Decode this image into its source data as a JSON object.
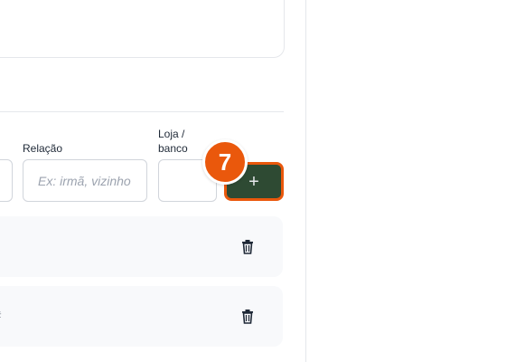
{
  "form": {
    "relacao_label": "Relação",
    "relacao_placeholder": "Ex: irmã, vizinho",
    "loja_label": "Loja / banco",
    "loja_value": "",
    "left_field_value": "",
    "add_label": "+"
  },
  "step_badge": "7",
  "list": {
    "items": [
      {
        "text": ""
      },
      {
        "text": "#"
      }
    ]
  },
  "colors": {
    "accent": "#ea580c",
    "button_bg": "#2e4a33",
    "card_bg": "#f8f9fb"
  },
  "icons": {
    "add": "plus-icon",
    "delete": "trash-icon"
  }
}
